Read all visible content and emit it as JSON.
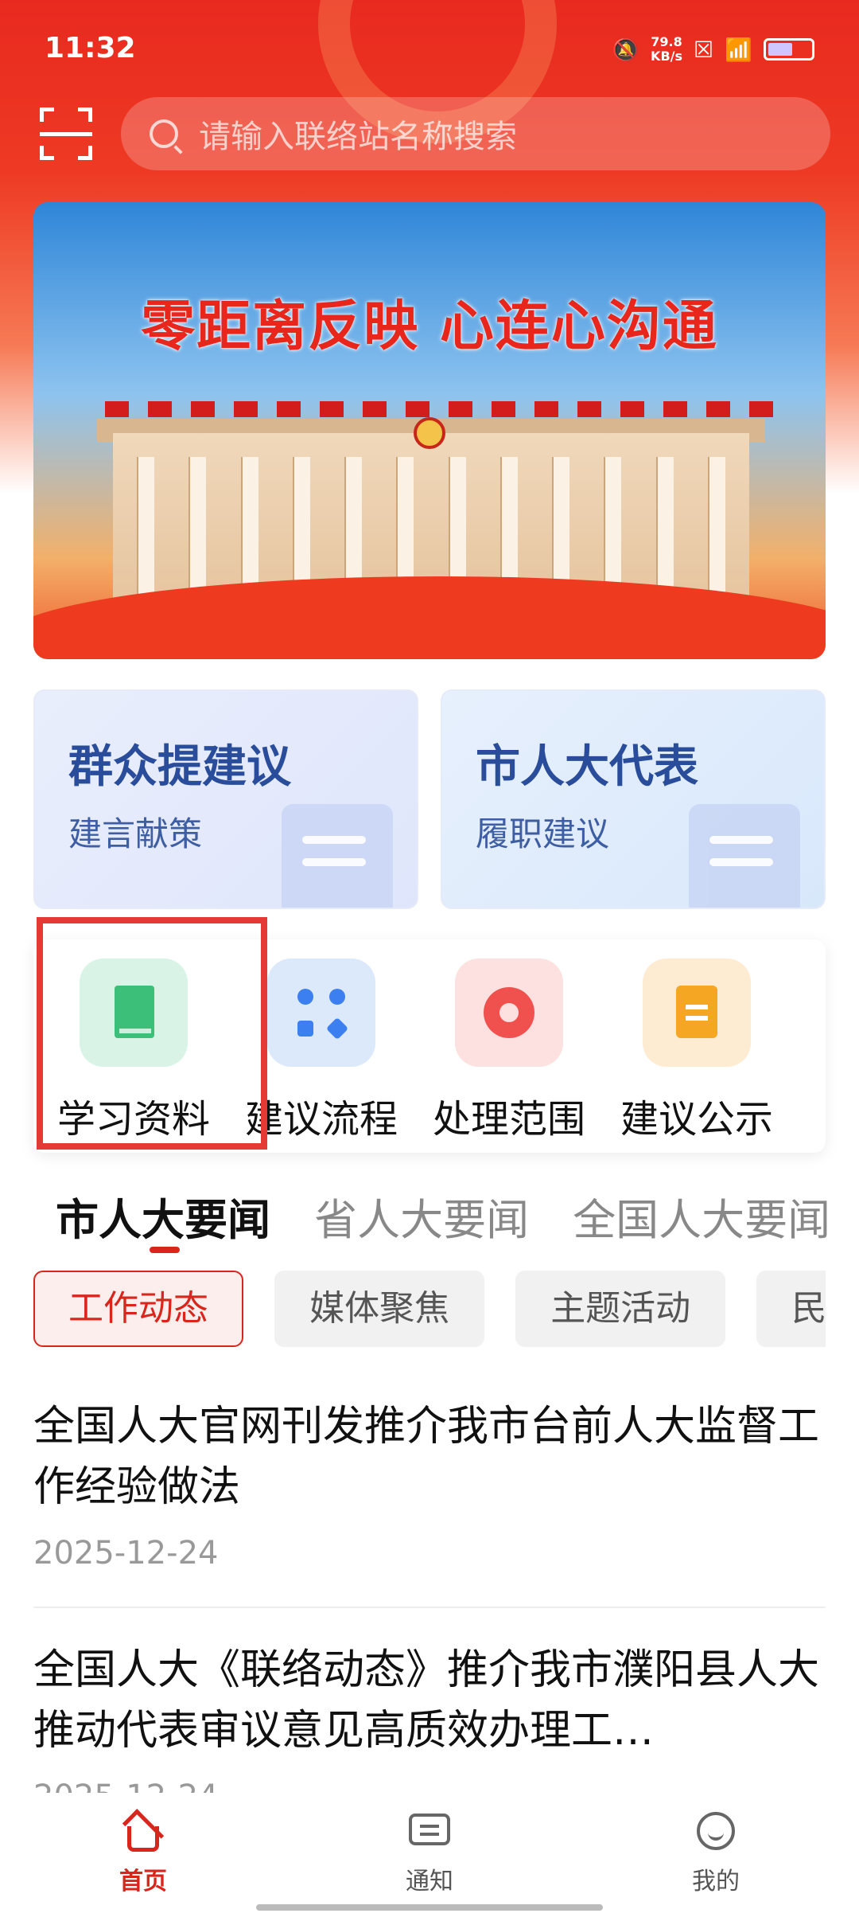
{
  "status_bar": {
    "time": "11:32",
    "speed_value": "79.8",
    "speed_unit": "KB/s"
  },
  "search": {
    "placeholder": "请输入联络站名称搜索"
  },
  "banner": {
    "slogan": "零距离反映  心连心沟通"
  },
  "cards": [
    {
      "title": "群众提建议",
      "subtitle": "建言献策"
    },
    {
      "title": "市人大代表",
      "subtitle": "履职建议"
    }
  ],
  "quick_menu": [
    {
      "label": "学习资料",
      "icon": "book-icon"
    },
    {
      "label": "建议流程",
      "icon": "flow-icon"
    },
    {
      "label": "处理范围",
      "icon": "target-icon"
    },
    {
      "label": "建议公示",
      "icon": "clipboard-icon"
    }
  ],
  "news_tabs": [
    "市人大要闻",
    "省人大要闻",
    "全国人大要闻"
  ],
  "chips": [
    "工作动态",
    "媒体聚焦",
    "主题活动",
    "民"
  ],
  "news": [
    {
      "title": "全国人大官网刊发推介我市台前人大监督工作经验做法",
      "date": "2025-12-24"
    },
    {
      "title": "全国人大《联络动态》推介我市濮阳县人大推动代表审议意见高质效办理工…",
      "date": "2025-12-24"
    }
  ],
  "bottom_nav": [
    {
      "label": "首页",
      "icon": "home-icon"
    },
    {
      "label": "通知",
      "icon": "message-icon"
    },
    {
      "label": "我的",
      "icon": "profile-icon"
    }
  ],
  "colors": {
    "primary": "#d9261c",
    "highlight_box": "#e53935"
  }
}
